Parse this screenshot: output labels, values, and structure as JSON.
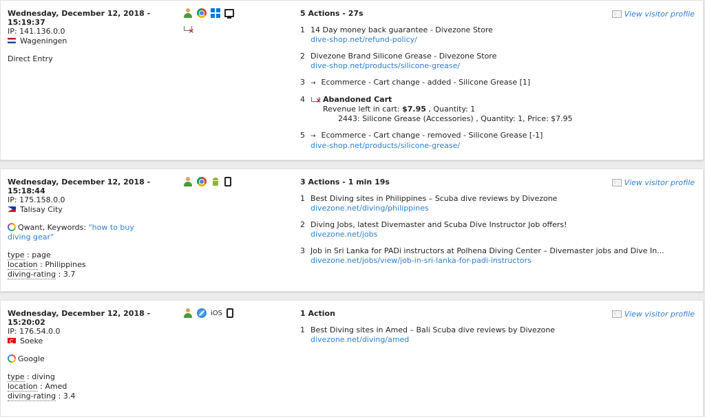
{
  "visits": [
    {
      "date_line": "Wednesday, December 12, 2018 -",
      "time": "15:19:37",
      "ip": "IP: 141.136.0.0",
      "city": "Wageningen",
      "flag": "nl",
      "referrer": "Direct Entry",
      "device_icons": [
        "visitor-icon",
        "chrome-icon",
        "windows-icon",
        "desktop-icon"
      ],
      "actions_title": "5 Actions - 27s",
      "profile_label": "View visitor profile",
      "actions": [
        {
          "num": "1",
          "title": "14 Day money back guarantee - Divezone Store",
          "url": "dive-shop.net/refund-policy/"
        },
        {
          "num": "2",
          "title": "Divezone Brand Silicone Grease - Divezone Store",
          "url": "dive-shop.net/products/silicone-grease/"
        },
        {
          "num": "3",
          "arrow": "→",
          "title": "Ecommerce - Cart change - added - Silicone Grease [1]"
        },
        {
          "num": "4",
          "cart_title": "Abandoned Cart",
          "revenue_prefix": "Revenue left in cart: ",
          "revenue_value": "$7.95",
          "revenue_suffix": " , Quantity: 1",
          "item_line": "2443: Silicone Grease (Accessories) , Quantity: 1, Price: $7.95"
        },
        {
          "num": "5",
          "arrow": "→",
          "title": "Ecommerce - Cart change - removed - Silicone Grease [-1]",
          "url": "dive-shop.net/products/silicone-grease/"
        }
      ]
    },
    {
      "date_line": "Wednesday, December 12, 2018 -",
      "time": "15:18:44",
      "ip": "IP: 175.158.0.0",
      "city": "Talisay City",
      "flag": "ph",
      "source": "Qwant",
      "keywords_prefix": ", Keywords: ",
      "keywords": "\"how to buy diving gear\"",
      "attributes": [
        {
          "key": "type",
          "value": " : page"
        },
        {
          "key": "location",
          "value": " : Philippines"
        },
        {
          "key": "diving-rating",
          "value": " : 3.7"
        }
      ],
      "actions_title": "3 Actions - 1 min 19s",
      "profile_label": "View visitor profile",
      "actions": [
        {
          "num": "1",
          "title": "Best Diving sites in Philippines – Scuba dive reviews by Divezone",
          "url": "divezone.net/diving/philippines"
        },
        {
          "num": "2",
          "title": "Diving Jobs, latest Divemaster and Scuba Dive Instructor Job offers!",
          "url": "divezone.net/jobs"
        },
        {
          "num": "3",
          "title": "Job in Sri Lanka for PADi instructors at Polhena Diving Center – Divemaster jobs and Dive In...",
          "url": "divezone.net/jobs/view/job-in-sri-lanka-for-padi-instructors"
        }
      ]
    },
    {
      "date_line": "Wednesday, December 12, 2018 -",
      "time": "15:20:02",
      "ip": "IP: 176.54.0.0",
      "city": "Soeke",
      "flag": "tr",
      "source": "Google",
      "os_label": "iOS",
      "attributes": [
        {
          "key": "type",
          "value": " : diving"
        },
        {
          "key": "location",
          "value": " : Amed"
        },
        {
          "key": "diving-rating",
          "value": " : 3.4"
        }
      ],
      "actions_title": "1 Action",
      "profile_label": "View visitor profile",
      "actions": [
        {
          "num": "1",
          "title": "Best Diving sites in Amed – Bali Scuba dive reviews by Divezone",
          "url": "divezone.net/diving/amed"
        }
      ]
    }
  ]
}
